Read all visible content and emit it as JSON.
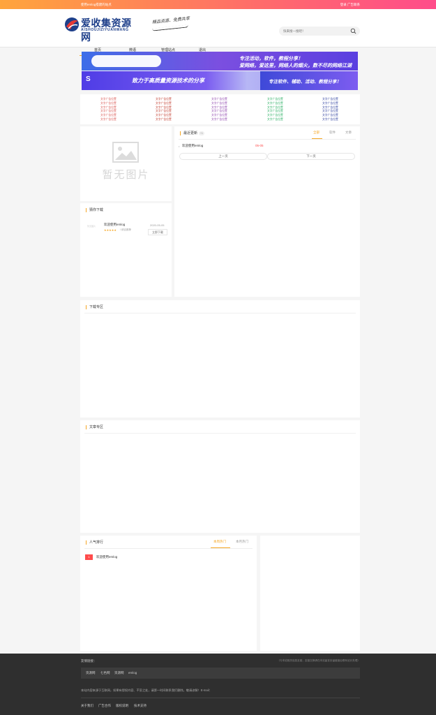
{
  "topbar": {
    "left_text": "使用emlog搭建的站点",
    "right_text": "登录  广告联系"
  },
  "header": {
    "logo_cn": "爱收集资源网",
    "logo_en": "AISHOUJIZIYUANWANG",
    "slogan": "精品资源、免费共享",
    "search_placeholder": "快来搜一搜吧！"
  },
  "nav": {
    "items": [
      "首页",
      "微语",
      "管理站点",
      "退出"
    ],
    "active": "首页"
  },
  "banners": {
    "b1_line1": "专注活动，软件，教程分享！",
    "b1_line2": "爱网络，爱这里，网络人的烟火，数不尽的网络江湖",
    "b2_left": "致力于高质量资源技术的分享",
    "b2_right": "专注软件、辅助、活动、教程分享！"
  },
  "ads": {
    "cell_text": "文字广告位置",
    "colors": [
      "#d9534f",
      "#c0392b",
      "#8e44ad",
      "#27ae60",
      "#2c3e9e"
    ]
  },
  "noimage": {
    "text": "暂无图片"
  },
  "latest": {
    "title": "最近更新",
    "badge": "+1",
    "tabs": [
      "全部",
      "软件",
      "文章"
    ],
    "active_tab": "全部",
    "items": [
      {
        "title": "欢迎使用emlog",
        "date": "05-05"
      }
    ],
    "prev": "上一页",
    "next": "下一页"
  },
  "guess": {
    "title": "猜你下载",
    "item": {
      "title": "欢迎使用emlog",
      "date": "2020-05-05",
      "stars": "★★★★★",
      "meta": "/ 综合推荐",
      "button": "立即下载",
      "thumb": "暂无图片"
    }
  },
  "download": {
    "title": "下载专区"
  },
  "article": {
    "title": "文章专区"
  },
  "hot": {
    "title": "人气排行",
    "tabs": [
      "本周热门",
      "本月热门"
    ],
    "active_tab": "本周热门",
    "items": [
      {
        "rank": "1",
        "title": "欢迎使用emlog"
      }
    ]
  },
  "footer": {
    "links_label": "友情链接：",
    "note": "（与本站相关信息友链，友链交换请在本站留言处留链接后联系站长处理）",
    "links": [
      "资源网",
      "七色网",
      "资源网",
      "emlog"
    ],
    "statement": "本站内容来源于互联网，如果有侵权内容、不妥之处，请第一时间联系我们删除。敬请谅解！E-mail：",
    "bottom_links": [
      "关于我们",
      "广告合作",
      "版权说明",
      "技术支持"
    ]
  }
}
